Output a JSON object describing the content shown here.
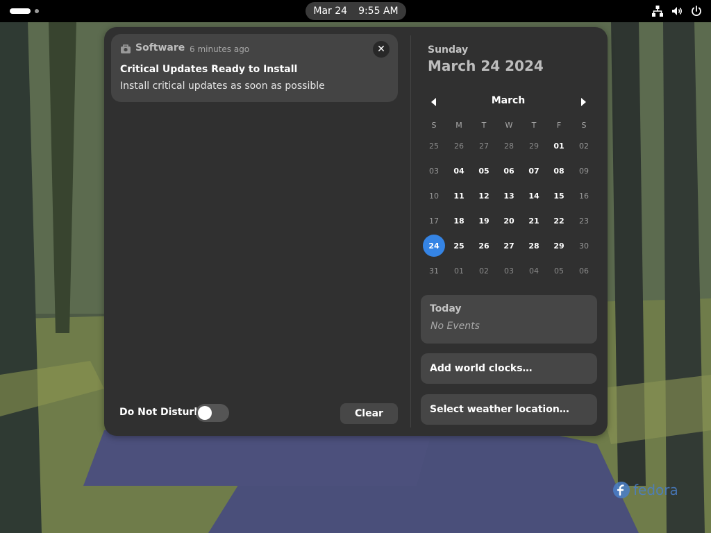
{
  "topbar": {
    "clock_date": "Mar 24",
    "clock_time": "9:55 AM",
    "tray_icons": [
      "network-icon",
      "volume-icon",
      "power-icon"
    ]
  },
  "notification": {
    "app_name": "Software",
    "time_ago": "6 minutes ago",
    "title": "Critical Updates Ready to Install",
    "body": "Install critical updates as soon as possible",
    "close_glyph": "✕"
  },
  "notifications_footer": {
    "dnd_label": "Do Not Disturb",
    "dnd_enabled": false,
    "clear_label": "Clear"
  },
  "calendar": {
    "day_name": "Sunday",
    "full_date": "March 24 2024",
    "month_label": "March",
    "weekday_headers": [
      "S",
      "M",
      "T",
      "W",
      "T",
      "F",
      "S"
    ],
    "weeks": [
      [
        "25",
        "26",
        "27",
        "28",
        "29",
        "01",
        "02"
      ],
      [
        "03",
        "04",
        "05",
        "06",
        "07",
        "08",
        "09"
      ],
      [
        "10",
        "11",
        "12",
        "13",
        "14",
        "15",
        "16"
      ],
      [
        "17",
        "18",
        "19",
        "20",
        "21",
        "22",
        "23"
      ],
      [
        "24",
        "25",
        "26",
        "27",
        "28",
        "29",
        "30"
      ],
      [
        "31",
        "01",
        "02",
        "03",
        "04",
        "05",
        "06"
      ]
    ],
    "selected_day": "24",
    "accent_color": "#3584e4"
  },
  "events": {
    "title": "Today",
    "empty_text": "No Events"
  },
  "buttons": {
    "world_clocks": "Add world clocks…",
    "weather": "Select weather location…"
  },
  "branding": {
    "logo_text": "fedora"
  }
}
